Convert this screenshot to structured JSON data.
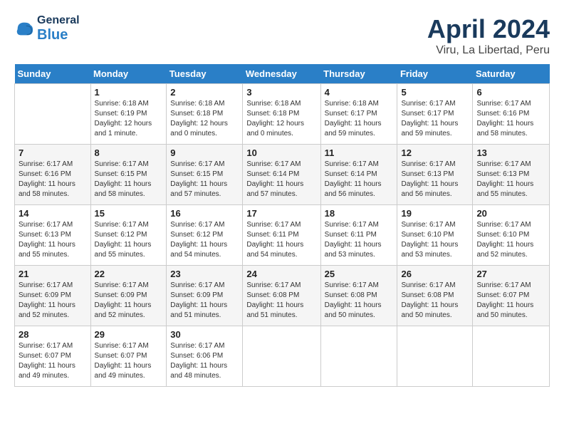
{
  "header": {
    "logo": {
      "general": "General",
      "blue": "Blue"
    },
    "title": "April 2024",
    "location": "Viru, La Libertad, Peru"
  },
  "weekdays": [
    "Sunday",
    "Monday",
    "Tuesday",
    "Wednesday",
    "Thursday",
    "Friday",
    "Saturday"
  ],
  "weeks": [
    [
      {
        "day": "",
        "sunrise": "",
        "sunset": "",
        "daylight": ""
      },
      {
        "day": "1",
        "sunrise": "Sunrise: 6:18 AM",
        "sunset": "Sunset: 6:19 PM",
        "daylight": "Daylight: 12 hours and 1 minute."
      },
      {
        "day": "2",
        "sunrise": "Sunrise: 6:18 AM",
        "sunset": "Sunset: 6:18 PM",
        "daylight": "Daylight: 12 hours and 0 minutes."
      },
      {
        "day": "3",
        "sunrise": "Sunrise: 6:18 AM",
        "sunset": "Sunset: 6:18 PM",
        "daylight": "Daylight: 12 hours and 0 minutes."
      },
      {
        "day": "4",
        "sunrise": "Sunrise: 6:18 AM",
        "sunset": "Sunset: 6:17 PM",
        "daylight": "Daylight: 11 hours and 59 minutes."
      },
      {
        "day": "5",
        "sunrise": "Sunrise: 6:17 AM",
        "sunset": "Sunset: 6:17 PM",
        "daylight": "Daylight: 11 hours and 59 minutes."
      },
      {
        "day": "6",
        "sunrise": "Sunrise: 6:17 AM",
        "sunset": "Sunset: 6:16 PM",
        "daylight": "Daylight: 11 hours and 58 minutes."
      }
    ],
    [
      {
        "day": "7",
        "sunrise": "Sunrise: 6:17 AM",
        "sunset": "Sunset: 6:16 PM",
        "daylight": "Daylight: 11 hours and 58 minutes."
      },
      {
        "day": "8",
        "sunrise": "Sunrise: 6:17 AM",
        "sunset": "Sunset: 6:15 PM",
        "daylight": "Daylight: 11 hours and 58 minutes."
      },
      {
        "day": "9",
        "sunrise": "Sunrise: 6:17 AM",
        "sunset": "Sunset: 6:15 PM",
        "daylight": "Daylight: 11 hours and 57 minutes."
      },
      {
        "day": "10",
        "sunrise": "Sunrise: 6:17 AM",
        "sunset": "Sunset: 6:14 PM",
        "daylight": "Daylight: 11 hours and 57 minutes."
      },
      {
        "day": "11",
        "sunrise": "Sunrise: 6:17 AM",
        "sunset": "Sunset: 6:14 PM",
        "daylight": "Daylight: 11 hours and 56 minutes."
      },
      {
        "day": "12",
        "sunrise": "Sunrise: 6:17 AM",
        "sunset": "Sunset: 6:13 PM",
        "daylight": "Daylight: 11 hours and 56 minutes."
      },
      {
        "day": "13",
        "sunrise": "Sunrise: 6:17 AM",
        "sunset": "Sunset: 6:13 PM",
        "daylight": "Daylight: 11 hours and 55 minutes."
      }
    ],
    [
      {
        "day": "14",
        "sunrise": "Sunrise: 6:17 AM",
        "sunset": "Sunset: 6:13 PM",
        "daylight": "Daylight: 11 hours and 55 minutes."
      },
      {
        "day": "15",
        "sunrise": "Sunrise: 6:17 AM",
        "sunset": "Sunset: 6:12 PM",
        "daylight": "Daylight: 11 hours and 55 minutes."
      },
      {
        "day": "16",
        "sunrise": "Sunrise: 6:17 AM",
        "sunset": "Sunset: 6:12 PM",
        "daylight": "Daylight: 11 hours and 54 minutes."
      },
      {
        "day": "17",
        "sunrise": "Sunrise: 6:17 AM",
        "sunset": "Sunset: 6:11 PM",
        "daylight": "Daylight: 11 hours and 54 minutes."
      },
      {
        "day": "18",
        "sunrise": "Sunrise: 6:17 AM",
        "sunset": "Sunset: 6:11 PM",
        "daylight": "Daylight: 11 hours and 53 minutes."
      },
      {
        "day": "19",
        "sunrise": "Sunrise: 6:17 AM",
        "sunset": "Sunset: 6:10 PM",
        "daylight": "Daylight: 11 hours and 53 minutes."
      },
      {
        "day": "20",
        "sunrise": "Sunrise: 6:17 AM",
        "sunset": "Sunset: 6:10 PM",
        "daylight": "Daylight: 11 hours and 52 minutes."
      }
    ],
    [
      {
        "day": "21",
        "sunrise": "Sunrise: 6:17 AM",
        "sunset": "Sunset: 6:09 PM",
        "daylight": "Daylight: 11 hours and 52 minutes."
      },
      {
        "day": "22",
        "sunrise": "Sunrise: 6:17 AM",
        "sunset": "Sunset: 6:09 PM",
        "daylight": "Daylight: 11 hours and 52 minutes."
      },
      {
        "day": "23",
        "sunrise": "Sunrise: 6:17 AM",
        "sunset": "Sunset: 6:09 PM",
        "daylight": "Daylight: 11 hours and 51 minutes."
      },
      {
        "day": "24",
        "sunrise": "Sunrise: 6:17 AM",
        "sunset": "Sunset: 6:08 PM",
        "daylight": "Daylight: 11 hours and 51 minutes."
      },
      {
        "day": "25",
        "sunrise": "Sunrise: 6:17 AM",
        "sunset": "Sunset: 6:08 PM",
        "daylight": "Daylight: 11 hours and 50 minutes."
      },
      {
        "day": "26",
        "sunrise": "Sunrise: 6:17 AM",
        "sunset": "Sunset: 6:08 PM",
        "daylight": "Daylight: 11 hours and 50 minutes."
      },
      {
        "day": "27",
        "sunrise": "Sunrise: 6:17 AM",
        "sunset": "Sunset: 6:07 PM",
        "daylight": "Daylight: 11 hours and 50 minutes."
      }
    ],
    [
      {
        "day": "28",
        "sunrise": "Sunrise: 6:17 AM",
        "sunset": "Sunset: 6:07 PM",
        "daylight": "Daylight: 11 hours and 49 minutes."
      },
      {
        "day": "29",
        "sunrise": "Sunrise: 6:17 AM",
        "sunset": "Sunset: 6:07 PM",
        "daylight": "Daylight: 11 hours and 49 minutes."
      },
      {
        "day": "30",
        "sunrise": "Sunrise: 6:17 AM",
        "sunset": "Sunset: 6:06 PM",
        "daylight": "Daylight: 11 hours and 48 minutes."
      },
      {
        "day": "",
        "sunrise": "",
        "sunset": "",
        "daylight": ""
      },
      {
        "day": "",
        "sunrise": "",
        "sunset": "",
        "daylight": ""
      },
      {
        "day": "",
        "sunrise": "",
        "sunset": "",
        "daylight": ""
      },
      {
        "day": "",
        "sunrise": "",
        "sunset": "",
        "daylight": ""
      }
    ]
  ]
}
